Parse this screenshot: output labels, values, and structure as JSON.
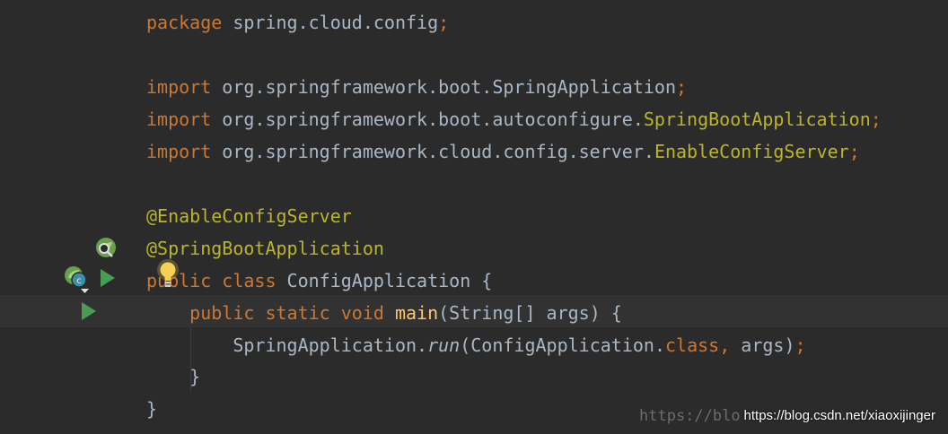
{
  "editor": {
    "lines": [
      {
        "id": "l1",
        "segments": [
          {
            "text": "package",
            "cls": "kw"
          },
          {
            "text": " spring.cloud.config",
            "cls": "plain"
          },
          {
            "text": ";",
            "cls": "kw"
          }
        ]
      },
      {
        "id": "l3",
        "segments": [
          {
            "text": "import",
            "cls": "kw"
          },
          {
            "text": " org.springframework.boot.SpringApplication",
            "cls": "plain"
          },
          {
            "text": ";",
            "cls": "kw"
          }
        ]
      },
      {
        "id": "l4",
        "segments": [
          {
            "text": "import",
            "cls": "kw"
          },
          {
            "text": " org.springframework.boot.autoconfigure.",
            "cls": "plain"
          },
          {
            "text": "SpringBootApplication",
            "cls": "ann"
          },
          {
            "text": ";",
            "cls": "kw"
          }
        ]
      },
      {
        "id": "l5",
        "segments": [
          {
            "text": "import",
            "cls": "kw"
          },
          {
            "text": " org.springframework.cloud.config.server.",
            "cls": "plain"
          },
          {
            "text": "EnableConfigServer",
            "cls": "ann"
          },
          {
            "text": ";",
            "cls": "kw"
          }
        ]
      },
      {
        "id": "l7",
        "segments": [
          {
            "text": "@EnableConfigServer",
            "cls": "ann"
          }
        ]
      },
      {
        "id": "l8",
        "segments": [
          {
            "text": "@SpringBootApplication",
            "cls": "ann"
          }
        ]
      },
      {
        "id": "l9",
        "segments": [
          {
            "text": "public",
            "cls": "kw"
          },
          {
            "text": " ",
            "cls": "plain"
          },
          {
            "text": "class",
            "cls": "kw"
          },
          {
            "text": " ConfigApplication {",
            "cls": "plain"
          }
        ]
      },
      {
        "id": "l10",
        "segments": [
          {
            "text": "    ",
            "cls": "plain"
          },
          {
            "text": "public static void",
            "cls": "kw"
          },
          {
            "text": " ",
            "cls": "plain"
          },
          {
            "text": "main",
            "cls": "fn"
          },
          {
            "text": "(String[] args) {",
            "cls": "plain"
          }
        ]
      },
      {
        "id": "l11",
        "segments": [
          {
            "text": "        SpringApplication.",
            "cls": "plain"
          },
          {
            "text": "run",
            "cls": "plain ital"
          },
          {
            "text": "(ConfigApplication.",
            "cls": "plain"
          },
          {
            "text": "class,",
            "cls": "kw"
          },
          {
            "text": " args)",
            "cls": "plain"
          },
          {
            "text": ";",
            "cls": "kw"
          }
        ]
      },
      {
        "id": "l12",
        "segments": [
          {
            "text": "    }",
            "cls": "plain"
          }
        ]
      },
      {
        "id": "l13",
        "segments": [
          {
            "text": "}",
            "cls": "plain"
          }
        ]
      }
    ]
  },
  "gutter": {
    "icons": [
      "spring-bean-search-icon",
      "spring-class-icon",
      "run-icon",
      "run-icon",
      "intention-bulb-icon"
    ]
  },
  "watermark": {
    "text": "https://blog.csdn.net/xiaoxijinger",
    "ghost": "https://blo"
  }
}
